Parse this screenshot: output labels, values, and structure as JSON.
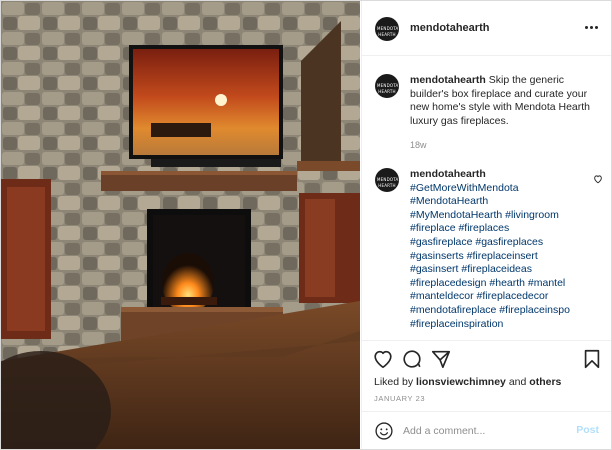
{
  "post": {
    "username": "mendotahearth",
    "avatar_logo_text": "MENDOTA HEARTH",
    "more_icon": "more-options-icon"
  },
  "caption": {
    "username": "mendotahearth",
    "text": "Skip the generic builder's box fireplace and curate your new home's style with Mendota Hearth luxury gas fireplaces.",
    "time": "18w"
  },
  "comment": {
    "username": "mendotahearth",
    "hashtags": [
      "#GetMoreWithMendota",
      "#MendotaHearth",
      "#MyMendotaHearth #livingroom",
      "#fireplace #fireplaces",
      "#gasfireplace #gasfireplaces",
      "#gasinserts #fireplaceinsert",
      "#gasinsert #fireplaceideas",
      "#fireplacedesign #hearth #mantel",
      "#manteldecor #fireplacedecor",
      "#mendotafireplace #fireplaceinspo",
      "#fireplaceinspiration"
    ]
  },
  "actions": {
    "like_icon": "heart-icon",
    "comment_icon": "comment-icon",
    "share_icon": "share-icon",
    "save_icon": "bookmark-icon"
  },
  "likes": {
    "prefix": "Liked by",
    "user": "lionsviewchimney",
    "connector": "and",
    "others": "others"
  },
  "date": "JANUARY 23",
  "add_comment": {
    "placeholder": "Add a comment...",
    "post_label": "Post"
  },
  "colors": {
    "link": "#00376b",
    "muted": "#8e8e8e",
    "post_disabled": "#b2dffc"
  }
}
